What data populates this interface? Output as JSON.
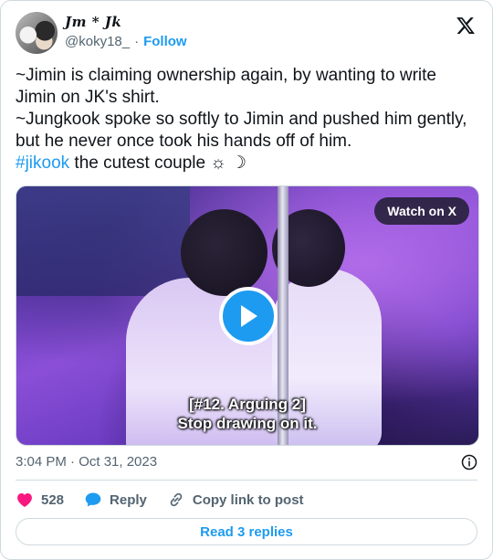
{
  "author": {
    "display_name": "Jm * Jk",
    "handle": "@koky18_",
    "separator": "·",
    "follow_label": "Follow"
  },
  "tweet": {
    "text_part1": "~Jimin is claiming ownership again, by wanting to write Jimin on JK's shirt.\n~Jungkook spoke so softly to Jimin and pushed him gently, but he never once took his hands off of him.\n",
    "hashtag": "#jikook",
    "text_part2": " the cutest couple ☼ ☽"
  },
  "media": {
    "watch_label": "Watch on X",
    "subtitle_line1": "[#12. Arguing 2]",
    "subtitle_line2": "Stop drawing on it."
  },
  "timestamp": "3:04 PM · Oct 31, 2023",
  "actions": {
    "likes_count": "528",
    "reply_label": "Reply",
    "copy_link_label": "Copy link to post"
  },
  "read_replies_label": "Read 3 replies",
  "colors": {
    "accent": "#1d9bf0",
    "like": "#f91880",
    "muted": "#536471",
    "border": "#cfd9de"
  },
  "icons": [
    "x-logo-icon",
    "play-icon",
    "info-icon",
    "heart-icon",
    "reply-bubble-icon",
    "link-icon"
  ]
}
